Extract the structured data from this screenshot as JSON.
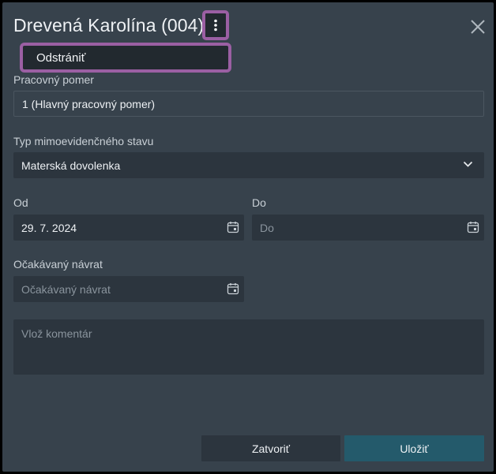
{
  "dialog": {
    "title": "Drevená Karolína (004)",
    "more_icon": "kebab-vertical-icon",
    "close_icon": "close-icon"
  },
  "menu": {
    "items": [
      {
        "label": "Odstrániť"
      }
    ]
  },
  "form": {
    "employment": {
      "label": "Pracovný pomer",
      "value": "1 (Hlavný pracovný pomer)"
    },
    "status_type": {
      "label": "Typ mimoevidenčného stavu",
      "value": "Materská dovolenka",
      "icon": "chevron-down-icon"
    },
    "from": {
      "label": "Od",
      "value": "29. 7. 2024",
      "icon": "calendar-icon"
    },
    "to": {
      "label": "Do",
      "placeholder": "Do",
      "icon": "calendar-icon"
    },
    "expected_return": {
      "label": "Očakávaný návrat",
      "placeholder": "Očakávaný návrat",
      "icon": "calendar-icon"
    },
    "comment": {
      "placeholder": "Vlož komentár"
    }
  },
  "footer": {
    "close_label": "Zatvoriť",
    "save_label": "Uložiť"
  },
  "colors": {
    "accent_highlight": "#9b5fa3",
    "primary_button": "#245a6b",
    "dialog_bg": "#37424c"
  }
}
